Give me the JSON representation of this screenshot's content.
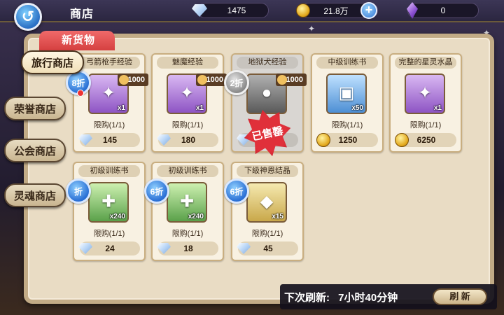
{
  "header": {
    "back_icon": "refresh-arrow-icon",
    "title": "商店",
    "diamonds": "1475",
    "gold": "21.8万",
    "crystals": "0",
    "plus": "+"
  },
  "section_tab": "新货物",
  "sidebar": {
    "items": [
      {
        "label": "旅行商店",
        "active": true
      },
      {
        "label": "荣誉商店",
        "active": false
      },
      {
        "label": "公会商店",
        "active": false
      },
      {
        "label": "灵魂商店",
        "active": false
      }
    ]
  },
  "cards": [
    {
      "name": "弓箭枪手经验",
      "discount": "8折",
      "tag": "1000",
      "qty": "x1",
      "limit": "限购(1/1)",
      "price": "145",
      "currency": "diamond",
      "item_color": "purple"
    },
    {
      "name": "魅魔经验",
      "discount": "",
      "tag": "1000",
      "qty": "x1",
      "limit": "限购(1/1)",
      "price": "180",
      "currency": "diamond",
      "item_color": "purple"
    },
    {
      "name": "地狱犬经验",
      "discount": "2折",
      "tag": "1000",
      "qty": "",
      "limit": "",
      "price": "",
      "currency": "diamond",
      "item_color": "gray",
      "sold_label": "已售罄"
    },
    {
      "name": "中级训练书",
      "discount": "",
      "tag": "",
      "qty": "x50",
      "limit": "限购(1/1)",
      "price": "1250",
      "currency": "gold",
      "item_color": "blue"
    },
    {
      "name": "完整的星灵水晶",
      "discount": "",
      "tag": "",
      "qty": "x1",
      "limit": "限购(1/1)",
      "price": "6250",
      "currency": "gold",
      "item_color": "purple"
    },
    {
      "name": "初级训练书",
      "discount": "折",
      "tag": "",
      "qty": "x240",
      "limit": "限购(1/1)",
      "price": "24",
      "currency": "diamond",
      "item_color": "green"
    },
    {
      "name": "初级训练书",
      "discount": "6折",
      "tag": "",
      "qty": "x240",
      "limit": "限购(1/1)",
      "price": "18",
      "currency": "diamond",
      "item_color": "green"
    },
    {
      "name": "下级神恩结晶",
      "discount": "6折",
      "tag": "",
      "qty": "x15",
      "limit": "限购(1/1)",
      "price": "45",
      "currency": "diamond",
      "item_color": "yellow"
    }
  ],
  "footer": {
    "refresh_label": "下次刷新:",
    "refresh_time": "7小时40分钟",
    "refresh_button": "刷 新"
  }
}
